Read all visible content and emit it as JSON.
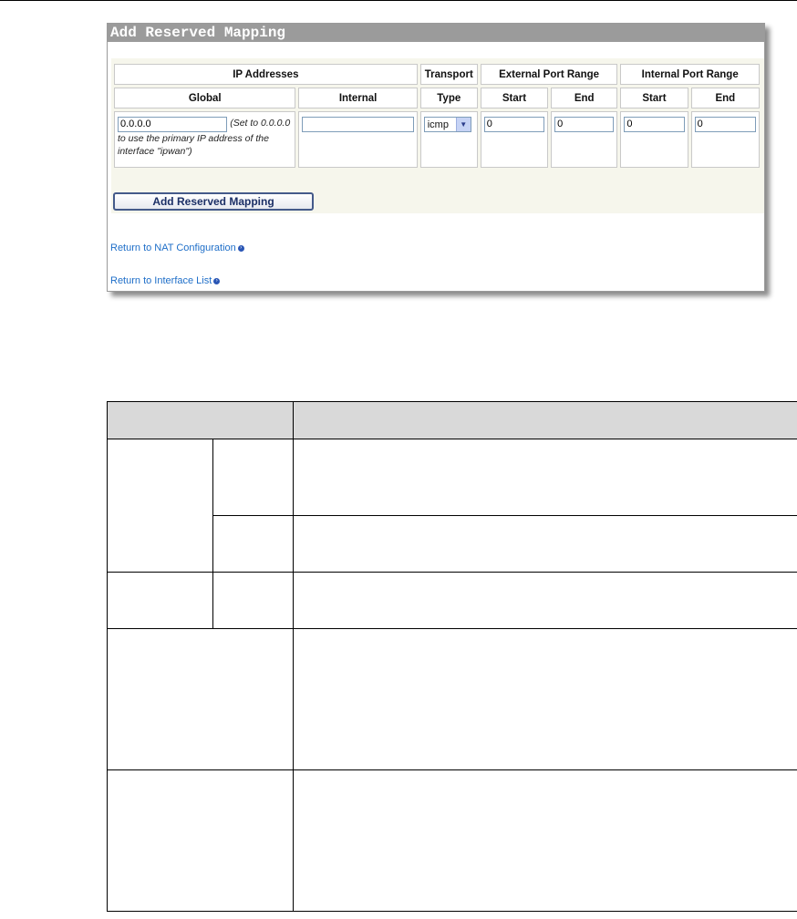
{
  "panel": {
    "title": "Add Reserved Mapping",
    "headers": {
      "ip_addresses": "IP Addresses",
      "transport": "Transport",
      "external_port_range": "External Port Range",
      "internal_port_range": "Internal Port Range",
      "global": "Global",
      "internal": "Internal",
      "type": "Type",
      "ext_start": "Start",
      "ext_end": "End",
      "int_start": "Start",
      "int_end": "End"
    },
    "fields": {
      "global_value": "0.0.0.0",
      "global_hint": "(Set to 0.0.0.0 to use the primary IP address of the interface \"ipwan\")",
      "internal_value": "",
      "type_value": "icmp",
      "ext_start_value": "0",
      "ext_end_value": "0",
      "int_start_value": "0",
      "int_end_value": "0"
    },
    "add_button": "Add Reserved Mapping",
    "links": {
      "nat_config": "Return to NAT Configuration",
      "interface_list": "Return to Interface List"
    }
  }
}
